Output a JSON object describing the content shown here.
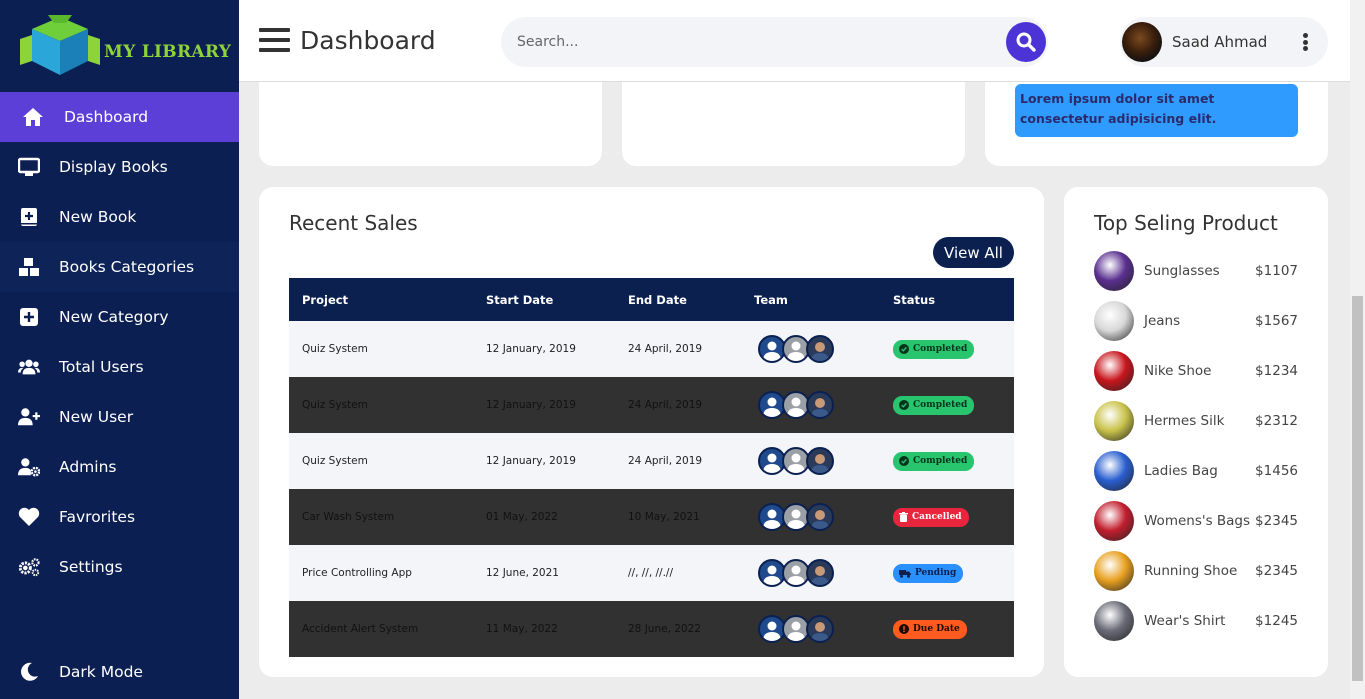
{
  "app": {
    "logo_text": "MY LIBRARY"
  },
  "sidebar": {
    "items": [
      {
        "label": "Dashboard",
        "icon": "home-icon",
        "active": true
      },
      {
        "label": "Display Books",
        "icon": "monitor-icon"
      },
      {
        "label": "New Book",
        "icon": "add-book-icon"
      },
      {
        "label": "Books Categories",
        "icon": "boxes-icon"
      },
      {
        "label": "New Category",
        "icon": "plus-square-icon"
      },
      {
        "label": "Total Users",
        "icon": "users-icon"
      },
      {
        "label": "New User",
        "icon": "user-plus-icon"
      },
      {
        "label": "Admins",
        "icon": "user-gear-icon"
      },
      {
        "label": "Favrorites",
        "icon": "heart-icon"
      },
      {
        "label": "Settings",
        "icon": "gears-icon"
      }
    ],
    "dark_mode_label": "Dark Mode"
  },
  "header": {
    "title": "Dashboard",
    "search_placeholder": "Search...",
    "user_name": "Saad Ahmad"
  },
  "top_card": {
    "note": "Lorem ipsum dolor sit amet consectetur adipisicing elit."
  },
  "recent_sales": {
    "title": "Recent Sales",
    "view_all": "View All",
    "columns": [
      "Project",
      "Start Date",
      "End Date",
      "Team",
      "Status"
    ],
    "rows": [
      {
        "project": "Quiz System",
        "start": "12 January, 2019",
        "end": "24 April, 2019",
        "status": "Completed"
      },
      {
        "project": "Quiz System",
        "start": "12 January, 2019",
        "end": "24 April, 2019",
        "status": "Completed"
      },
      {
        "project": "Quiz System",
        "start": "12 January, 2019",
        "end": "24 April, 2019",
        "status": "Completed"
      },
      {
        "project": "Car Wash System",
        "start": "01 May, 2022",
        "end": "10 May, 2021",
        "status": "Cancelled"
      },
      {
        "project": "Price Controlling App",
        "start": "12 June, 2021",
        "end": "//, //, //.//",
        "status": "Pending"
      },
      {
        "project": "Accident Alert System",
        "start": "11 May, 2022",
        "end": "28 June, 2022",
        "status": "Due Date"
      }
    ]
  },
  "top_products": {
    "title": "Top Seling Product",
    "items": [
      {
        "name": "Sunglasses",
        "price": "$1107",
        "color": "#5a2f8f"
      },
      {
        "name": "Jeans",
        "price": "$1567",
        "color": "#d8d8d8"
      },
      {
        "name": "Nike Shoe",
        "price": "$1234",
        "color": "#c8161d"
      },
      {
        "name": "Hermes Silk",
        "price": "$2312",
        "color": "#c9c24a"
      },
      {
        "name": "Ladies Bag",
        "price": "$1456",
        "color": "#2a5fd0"
      },
      {
        "name": "Womens's Bags",
        "price": "$2345",
        "color": "#c21e2e"
      },
      {
        "name": "Running Shoe",
        "price": "$2345",
        "color": "#e8a020"
      },
      {
        "name": "Wear's Shirt",
        "price": "$1245",
        "color": "#6b6b78"
      }
    ]
  },
  "colors": {
    "sidebar_bg": "#0c1f52",
    "accent": "#5b3fd7",
    "completed": "#29c46e",
    "cancelled": "#e8253d",
    "pending": "#2a8fff",
    "due": "#ff5a1f"
  }
}
